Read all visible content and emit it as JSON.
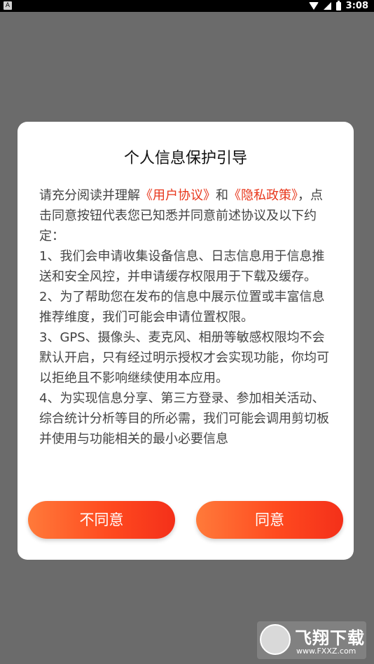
{
  "status_bar": {
    "notification_badge": "A",
    "time": "3:08",
    "icons": [
      "wifi-icon",
      "signal-icon",
      "battery-icon"
    ]
  },
  "dialog": {
    "title": "个人信息保护引导",
    "intro_prefix": "请充分阅读并理解",
    "user_agreement_link": "《用户协议》",
    "and_text": "和",
    "privacy_policy_link": "《隐私政策》",
    "intro_suffix": "，点击同意按钮代表您已知悉并同意前述协议及以下约定：",
    "items": [
      "1、我们会申请收集设备信息、日志信息用于信息推送和安全风控，并申请缓存权限用于下载及缓存。",
      "2、为了帮助您在发布的信息中展示位置或丰富信息推荐维度，我们可能会申请位置权限。",
      "3、GPS、摄像头、麦克风、相册等敏感权限均不会默认开启，只有经过明示授权才会实现功能，你均可以拒绝且不影响继续使用本应用。",
      "4、为实现信息分享、第三方登录、参加相关活动、综合统计分析等目的所必需，我们可能会调用剪切板并使用与功能相关的最小必要信息"
    ],
    "disagree_button": "不同意",
    "agree_button": "同意"
  },
  "colors": {
    "link": "#e8361b",
    "button_gradient_start": "#ff7a3a",
    "button_gradient_end": "#f4301a",
    "overlay": "#6b6b6b"
  },
  "watermark": {
    "brand": "飞翔下载",
    "url": "www.FXXZ.com"
  }
}
